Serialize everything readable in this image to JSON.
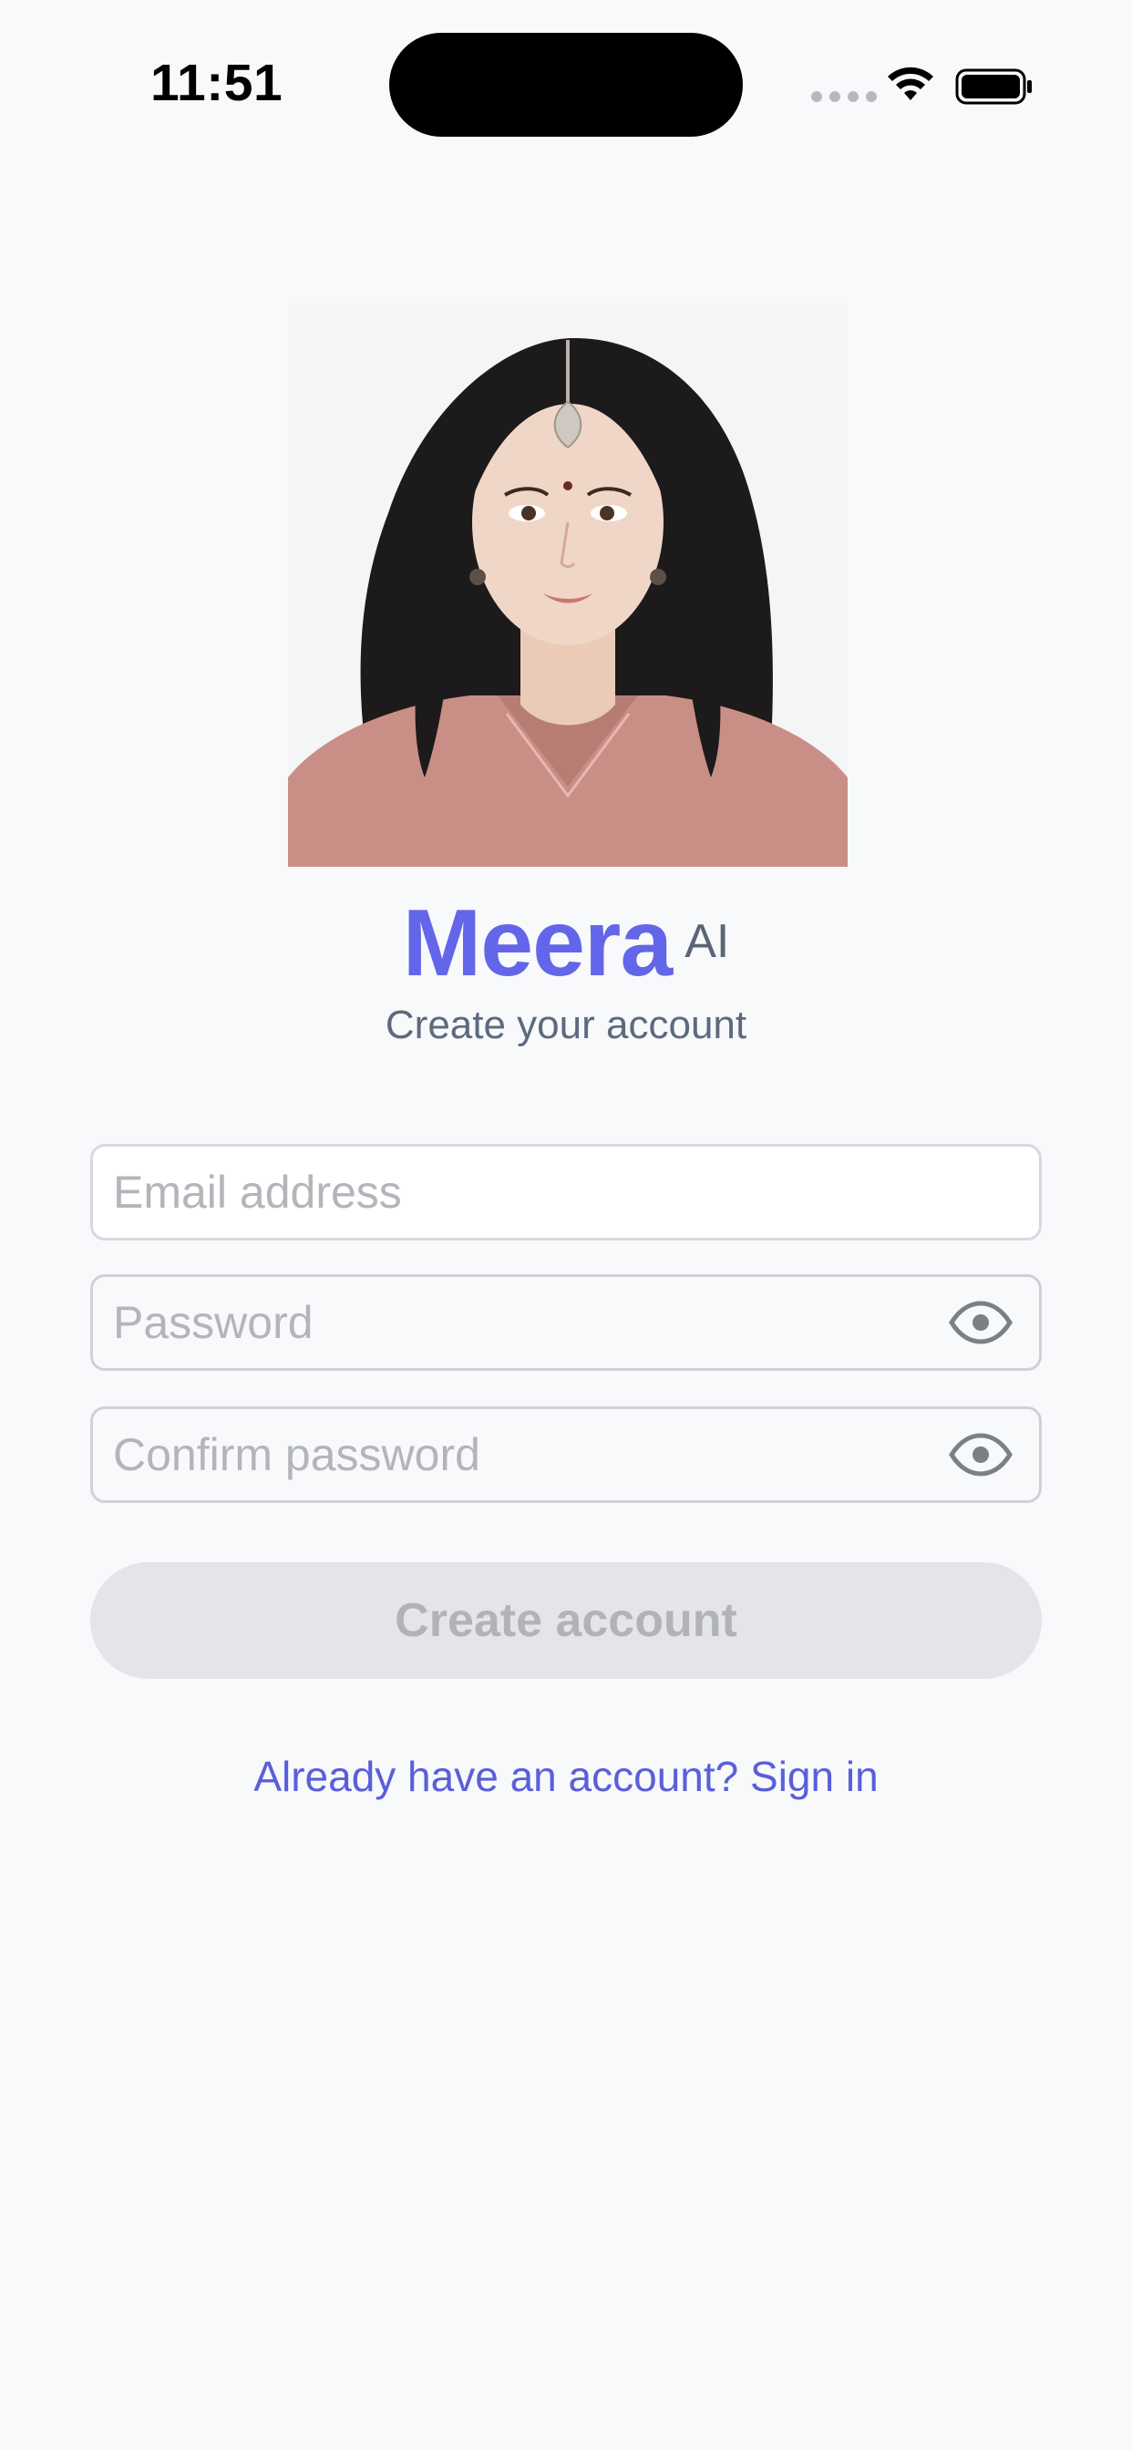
{
  "status_bar": {
    "time": "11:51",
    "icons": [
      "cellular-signal-icon",
      "wifi-icon",
      "battery-icon"
    ]
  },
  "avatar": {
    "icon": "profile-portrait-image"
  },
  "brand": {
    "name": "Meera",
    "suffix": "AI",
    "accent_color": "#6366e8"
  },
  "subtitle": "Create your account",
  "form": {
    "email": {
      "placeholder": "Email address",
      "value": ""
    },
    "password": {
      "placeholder": "Password",
      "value": "",
      "toggle_icon": "eye-icon"
    },
    "confirm_password": {
      "placeholder": "Confirm password",
      "value": "",
      "toggle_icon": "eye-icon"
    },
    "submit_label": "Create account",
    "submit_enabled": false
  },
  "signin_link": "Already have an account? Sign in"
}
